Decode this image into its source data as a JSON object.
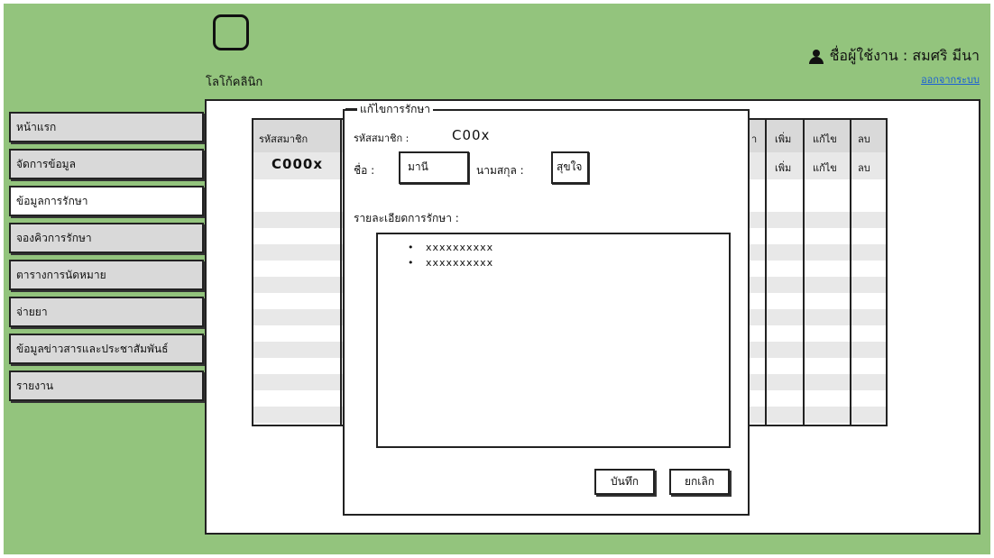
{
  "header": {
    "logo_label": "โลโก้คลินิก",
    "user_label": "ชื่อผู้ใช้งาน : สมศริ  มีนา",
    "logout_label": "ออกจากระบบ",
    "user_icon": "user-icon"
  },
  "sidebar": {
    "items": [
      {
        "label": "หน้าแรก",
        "active": false
      },
      {
        "label": "จัดการข้อมูล",
        "active": false
      },
      {
        "label": "ข้อมูลการรักษา",
        "active": true
      },
      {
        "label": "จองคิวการรักษา",
        "active": false
      },
      {
        "label": "ตารางการนัดหมาย",
        "active": false
      },
      {
        "label": "จ่ายยา",
        "active": false
      },
      {
        "label": "ข้อมูลข่าวสารและประชาสัมพันธ์",
        "active": false
      },
      {
        "label": "รายงาน",
        "active": false
      }
    ]
  },
  "table": {
    "headers": {
      "member_id": "รหัสสมาชิก",
      "col_partial": "า",
      "add": "เพิ่ม",
      "edit": "แก้ไข",
      "delete": "ลบ"
    },
    "row": {
      "member_id": "C000x",
      "add": "เพิ่ม",
      "edit": "แก้ไข",
      "delete": "ลบ"
    }
  },
  "dialog": {
    "title": "แก้ไขการรักษา",
    "member_id_label": "รหัสสมาชิก :",
    "member_id_value": "C00x",
    "first_name_label": "ชื่อ :",
    "first_name_value": "มานี",
    "last_name_label": "นามสกุล :",
    "last_name_value": "สุขใจ",
    "details_label": "รายละเอียดการรักษา :",
    "details_items": [
      "xxxxxxxxxx",
      "xxxxxxxxxx"
    ],
    "save_label": "บันทึก",
    "cancel_label": "ยกเลิก"
  }
}
